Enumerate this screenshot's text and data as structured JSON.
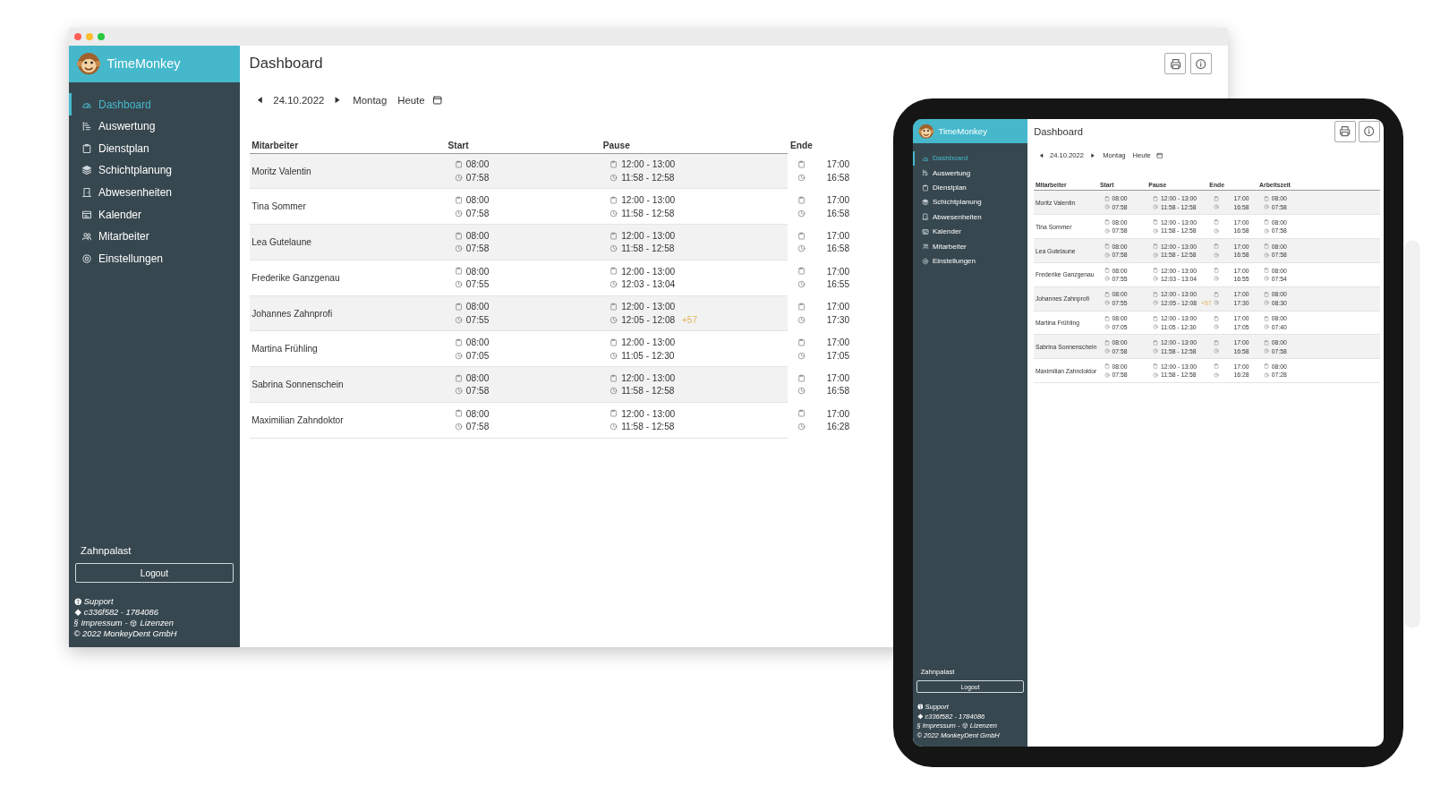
{
  "desktop_window": {
    "sidebar": {
      "brand": "TimeMonkey",
      "items": [
        {
          "label": "Dashboard",
          "selected": true
        },
        {
          "label": "Auswertung",
          "selected": false
        },
        {
          "label": "Dienstplan",
          "selected": false
        },
        {
          "label": "Schichtplanung",
          "selected": false
        },
        {
          "label": "Abwesenheiten",
          "selected": false
        },
        {
          "label": "Kalender",
          "selected": false
        },
        {
          "label": "Mitarbeiter",
          "selected": false
        },
        {
          "label": "Einstellungen",
          "selected": false
        }
      ],
      "company": "Zahnpalast",
      "logout": "Logout",
      "footer": {
        "support": "Support",
        "version": "c336f582 - 1784086",
        "impressum": "§ Impressum",
        "separator": "-",
        "licenses": "Lizenzen",
        "copyright": "© 2022 MonkeyDent GmbH"
      }
    },
    "main": {
      "title": "Dashboard",
      "date_nav": {
        "date": "24.10.2022",
        "weekday": "Montag",
        "today": "Heute"
      },
      "table": {
        "columns": [
          "Mitarbeiter",
          "Start",
          "Pause",
          "Ende"
        ],
        "rows": [
          {
            "name": "Moritz Valentin",
            "times": [
              {
                "planned": "08:00",
                "actual": "07:58"
              },
              {
                "planned": "12:00 - 13:00",
                "actual": "11:58 - 12:58"
              },
              {
                "planned": "17:00",
                "actual": "16:58"
              }
            ]
          },
          {
            "name": "Tina Sommer",
            "times": [
              {
                "planned": "08:00",
                "actual": "07:58"
              },
              {
                "planned": "12:00 - 13:00",
                "actual": "11:58 - 12:58"
              },
              {
                "planned": "17:00",
                "actual": "16:58"
              }
            ]
          },
          {
            "name": "Lea Gutelaune",
            "times": [
              {
                "planned": "08:00",
                "actual": "07:58"
              },
              {
                "planned": "12:00 - 13:00",
                "actual": "11:58 - 12:58"
              },
              {
                "planned": "17:00",
                "actual": "16:58"
              }
            ]
          },
          {
            "name": "Frederike Ganzgenau",
            "times": [
              {
                "planned": "08:00",
                "actual": "07:55"
              },
              {
                "planned": "12:00 - 13:00",
                "actual": "12:03 - 13:04"
              },
              {
                "planned": "17:00",
                "actual": "16:55"
              }
            ]
          },
          {
            "name": "Johannes Zahnprofi",
            "times": [
              {
                "planned": "08:00",
                "actual": "07:55"
              },
              {
                "planned": "12:00 - 13:00",
                "actual": "12:05 - 12:08",
                "extra": "+57"
              },
              {
                "planned": "17:00",
                "actual": "17:30"
              }
            ]
          },
          {
            "name": "Martina Frühling",
            "times": [
              {
                "planned": "08:00",
                "actual": "07:05"
              },
              {
                "planned": "12:00 - 13:00",
                "actual": "11:05 - 12:30"
              },
              {
                "planned": "17:00",
                "actual": "17:05"
              }
            ]
          },
          {
            "name": "Sabrina Sonnenschein",
            "times": [
              {
                "planned": "08:00",
                "actual": "07:58"
              },
              {
                "planned": "12:00 - 13:00",
                "actual": "11:58 - 12:58"
              },
              {
                "planned": "17:00",
                "actual": "16:58"
              }
            ]
          },
          {
            "name": "Maximilian Zahndoktor",
            "times": [
              {
                "planned": "08:00",
                "actual": "07:58"
              },
              {
                "planned": "12:00 - 13:00",
                "actual": "11:58 - 12:58"
              },
              {
                "planned": "17:00",
                "actual": "16:28"
              }
            ]
          }
        ]
      }
    }
  },
  "tablet": {
    "sidebar": {
      "brand": "TimeMonkey",
      "items": [
        {
          "label": "Dashboard",
          "selected": true
        },
        {
          "label": "Auswertung",
          "selected": false
        },
        {
          "label": "Dienstplan",
          "selected": false
        },
        {
          "label": "Schichtplanung",
          "selected": false
        },
        {
          "label": "Abwesenheiten",
          "selected": false
        },
        {
          "label": "Kalender",
          "selected": false
        },
        {
          "label": "Mitarbeiter",
          "selected": false
        },
        {
          "label": "Einstellungen",
          "selected": false
        }
      ],
      "company": "Zahnpalast",
      "logout": "Logout",
      "footer": {
        "support": "Support",
        "version": "c336f582 - 1784086",
        "impressum": "§ Impressum",
        "separator": "-",
        "licenses": "Lizenzen",
        "copyright": "© 2022 MonkeyDent GmbH"
      }
    },
    "main": {
      "title": "Dashboard",
      "date_nav": {
        "date": "24.10.2022",
        "weekday": "Montag",
        "today": "Heute"
      },
      "table": {
        "columns": [
          "Mitarbeiter",
          "Start",
          "Pause",
          "Ende",
          "Arbeitszeit"
        ],
        "rows": [
          {
            "name": "Moritz Valentin",
            "times": [
              {
                "planned": "08:00",
                "actual": "07:58"
              },
              {
                "planned": "12:00 - 13:00",
                "actual": "11:58 - 12:58"
              },
              {
                "planned": "17:00",
                "actual": "16:58"
              },
              {
                "planned": "08:00",
                "actual": "07:58"
              }
            ]
          },
          {
            "name": "Tina Sommer",
            "times": [
              {
                "planned": "08:00",
                "actual": "07:58"
              },
              {
                "planned": "12:00 - 13:00",
                "actual": "11:58 - 12:58"
              },
              {
                "planned": "17:00",
                "actual": "16:58"
              },
              {
                "planned": "08:00",
                "actual": "07:58"
              }
            ]
          },
          {
            "name": "Lea Gutelaune",
            "times": [
              {
                "planned": "08:00",
                "actual": "07:58"
              },
              {
                "planned": "12:00 - 13:00",
                "actual": "11:58 - 12:58"
              },
              {
                "planned": "17:00",
                "actual": "16:58"
              },
              {
                "planned": "08:00",
                "actual": "07:58"
              }
            ]
          },
          {
            "name": "Frederike Ganzgenau",
            "times": [
              {
                "planned": "08:00",
                "actual": "07:55"
              },
              {
                "planned": "12:00 - 13:00",
                "actual": "12:03 - 13:04"
              },
              {
                "planned": "17:00",
                "actual": "16:55"
              },
              {
                "planned": "08:00",
                "actual": "07:54"
              }
            ]
          },
          {
            "name": "Johannes Zahnprofi",
            "times": [
              {
                "planned": "08:00",
                "actual": "07:55"
              },
              {
                "planned": "12:00 - 13:00",
                "actual": "12:05 - 12:08",
                "extra": "+57"
              },
              {
                "planned": "17:00",
                "actual": "17:30"
              },
              {
                "planned": "08:00",
                "actual": "08:30"
              }
            ]
          },
          {
            "name": "Martina Frühling",
            "times": [
              {
                "planned": "08:00",
                "actual": "07:05"
              },
              {
                "planned": "12:00 - 13:00",
                "actual": "11:05 - 12:30"
              },
              {
                "planned": "17:00",
                "actual": "17:05"
              },
              {
                "planned": "08:00",
                "actual": "07:40"
              }
            ]
          },
          {
            "name": "Sabrina Sonnenschein",
            "times": [
              {
                "planned": "08:00",
                "actual": "07:58"
              },
              {
                "planned": "12:00 - 13:00",
                "actual": "11:58 - 12:58"
              },
              {
                "planned": "17:00",
                "actual": "16:58"
              },
              {
                "planned": "08:00",
                "actual": "07:58"
              }
            ]
          },
          {
            "name": "Maximilian Zahndoktor",
            "times": [
              {
                "planned": "08:00",
                "actual": "07:58"
              },
              {
                "planned": "12:00 - 13:00",
                "actual": "11:58 - 12:58"
              },
              {
                "planned": "17:00",
                "actual": "16:28"
              },
              {
                "planned": "08:00",
                "actual": "07:28"
              }
            ]
          }
        ]
      }
    }
  }
}
